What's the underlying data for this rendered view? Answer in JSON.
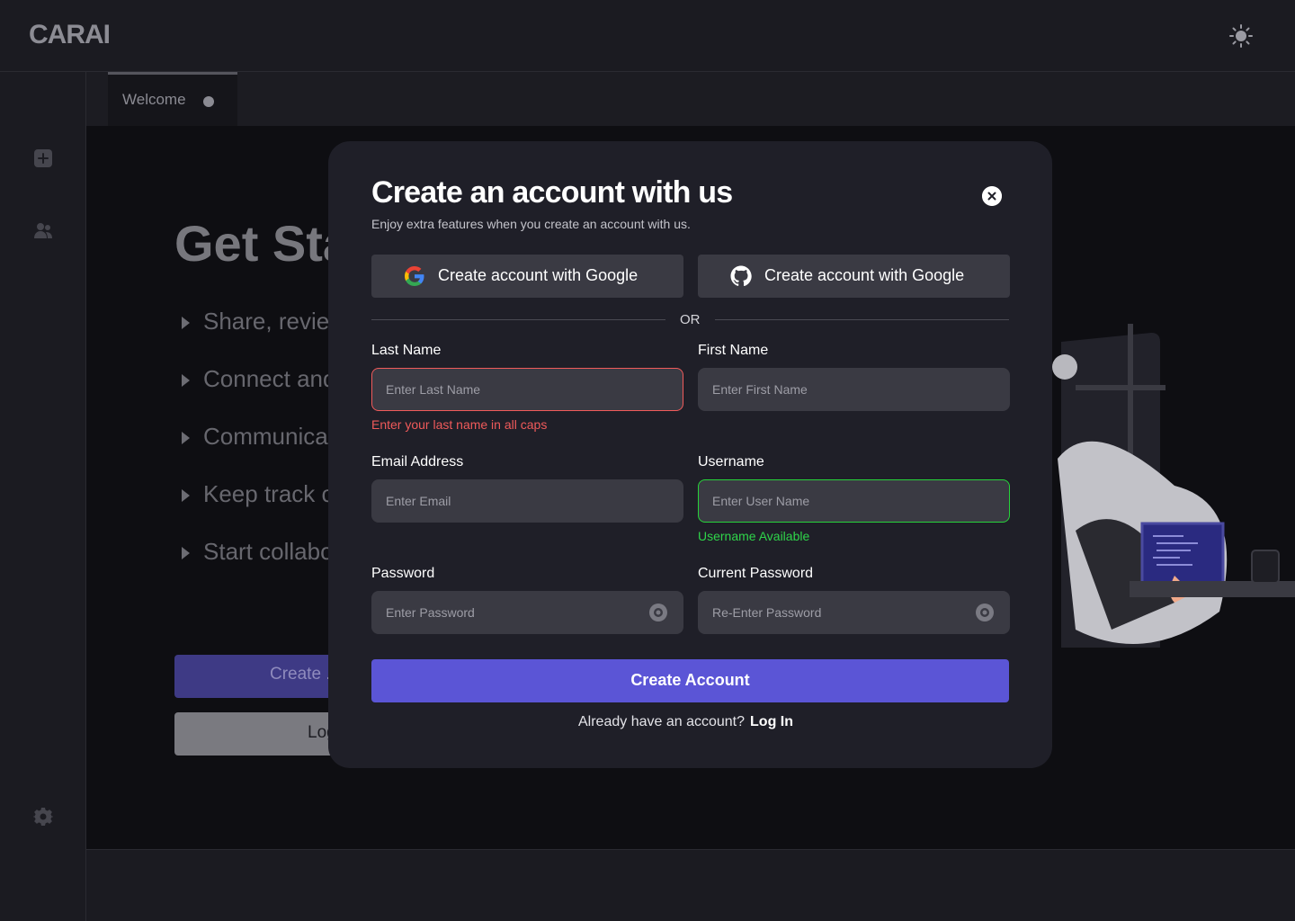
{
  "header": {
    "logo": "CARAI",
    "theme_toggle_icon": "sun-icon"
  },
  "sidebar": {
    "icons": [
      {
        "name": "add-square-icon"
      },
      {
        "name": "users-icon"
      },
      {
        "name": "gear-icon"
      }
    ]
  },
  "tabs": [
    {
      "label": "Welcome"
    }
  ],
  "background": {
    "hero_title": "Get Sta",
    "features": [
      "Share, reviev",
      "Connect and",
      "Communicat",
      "Keep track c",
      "Start collabo"
    ],
    "create_button": "Create .",
    "login_button": "Log"
  },
  "modal": {
    "title": "Create an account with us",
    "subtitle": "Enjoy extra features when you create an account with us.",
    "oauth": [
      {
        "label": "Create account with Google",
        "icon": "google-icon"
      },
      {
        "label": "Create account with Google",
        "icon": "github-icon"
      }
    ],
    "divider": "OR",
    "fields": {
      "last_name": {
        "label": "Last Name",
        "placeholder": "Enter Last Name",
        "value": "",
        "error": "Enter your last name in all caps"
      },
      "first_name": {
        "label": "First Name",
        "placeholder": "Enter First Name",
        "value": ""
      },
      "email": {
        "label": "Email Address",
        "placeholder": "Enter Email",
        "value": ""
      },
      "username": {
        "label": "Username",
        "placeholder": "Enter User Name",
        "value": "",
        "success": "Username Available"
      },
      "password": {
        "label": "Password",
        "placeholder": "Enter Password",
        "value": ""
      },
      "confirm_password": {
        "label": "Current Password",
        "placeholder": "Re-Enter Password",
        "value": ""
      }
    },
    "submit": "Create Account",
    "login_prompt": "Already have an account?",
    "login_link": "Log In"
  },
  "colors": {
    "accent": "#5b55d6",
    "error": "#f05b5b",
    "success": "#27d33a",
    "modal_bg": "#1f1f28",
    "input_bg": "#3a3a43"
  }
}
